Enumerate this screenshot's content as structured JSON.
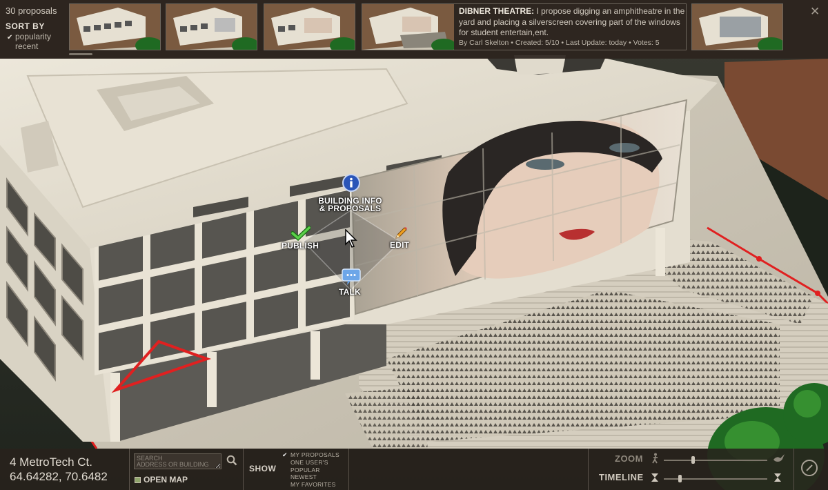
{
  "topbar": {
    "proposal_count": "30 proposals",
    "sort_title": "SORT BY",
    "sort_options": [
      {
        "label": "popularity",
        "selected": true
      },
      {
        "label": "recent",
        "selected": false
      }
    ],
    "close_label": "✕"
  },
  "proposal": {
    "title": "DIBNER THEATRE:",
    "description": "I propose digging an amphitheatre in the yard and placing a silverscreen covering part of the windows for student entertain,ent.",
    "meta": "By Carl Skelton • Created: 5/10 • Last Update: today  • Votes: 5"
  },
  "radial_menu": {
    "info_label_line1": "BUILDING INFO",
    "info_label_line2": "& PROPOSALS",
    "publish_label": "PUBLISH",
    "edit_label": "EDIT",
    "talk_label": "TALK"
  },
  "bottombar": {
    "address_line1": "4 MetroTech Ct.",
    "address_line2": "64.64282, 70.6482",
    "search_placeholder": "SEARCH\nADDRESS OR BUILDING",
    "open_map_label": "OPEN MAP",
    "show_label": "SHOW",
    "show_options": [
      {
        "label": "MY PROPOSALS",
        "checked": true
      },
      {
        "label": "ONE USER'S",
        "checked": false
      },
      {
        "label": "POPULAR",
        "checked": false
      },
      {
        "label": "NEWEST",
        "checked": false
      },
      {
        "label": "MY FAVORITES",
        "checked": false
      }
    ],
    "zoom_label": "ZOOM",
    "timeline_label": "TIMELINE"
  },
  "colors": {
    "highlight_red": "#e02020",
    "bar_bg": "#2c241e",
    "building": "#e6e0d2"
  }
}
